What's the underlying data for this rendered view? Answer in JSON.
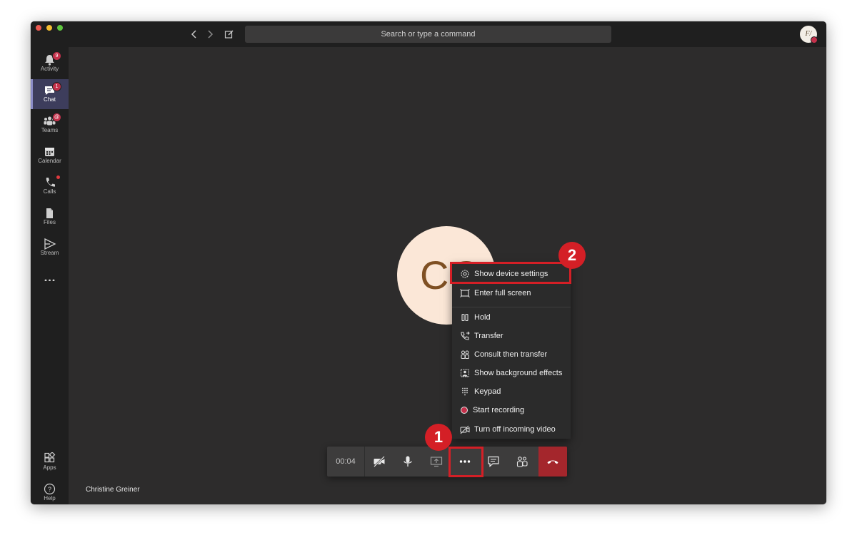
{
  "window": {
    "search_placeholder": "Search or type a command",
    "user_avatar_initials": "F/"
  },
  "sidebar": {
    "items": [
      {
        "label": "Activity",
        "icon": "bell-icon",
        "badge": "9"
      },
      {
        "label": "Chat",
        "icon": "chat-icon",
        "badge": "1",
        "active": true
      },
      {
        "label": "Teams",
        "icon": "teams-icon",
        "badge": "@"
      },
      {
        "label": "Calendar",
        "icon": "calendar-icon"
      },
      {
        "label": "Calls",
        "icon": "phone-icon",
        "badge_dot": true
      },
      {
        "label": "Files",
        "icon": "file-icon"
      },
      {
        "label": "Stream",
        "icon": "stream-icon"
      }
    ],
    "more_icon": "more-icon",
    "bottom_items": [
      {
        "label": "Apps",
        "icon": "apps-icon"
      },
      {
        "label": "Help",
        "icon": "help-icon"
      }
    ]
  },
  "call": {
    "caller_initials": "CG",
    "caller_name": "Christine Greiner",
    "duration": "00:04"
  },
  "more_menu": {
    "items": [
      {
        "label": "Show device settings",
        "icon": "gear-icon"
      },
      {
        "label": "Enter full screen",
        "icon": "fullscreen-icon"
      },
      {
        "label": "Hold",
        "icon": "hold-icon"
      },
      {
        "label": "Transfer",
        "icon": "transfer-icon"
      },
      {
        "label": "Consult then transfer",
        "icon": "consult-icon"
      },
      {
        "label": "Show background effects",
        "icon": "background-effects-icon"
      },
      {
        "label": "Keypad",
        "icon": "keypad-icon"
      },
      {
        "label": "Start recording",
        "icon": "record-icon"
      },
      {
        "label": "Turn off incoming video",
        "icon": "video-off-icon"
      }
    ]
  },
  "toolbar": {
    "buttons": [
      "camera-off-icon",
      "microphone-icon",
      "share-screen-icon",
      "more-options-icon",
      "chat-icon",
      "participants-icon",
      "hang-up-icon"
    ]
  },
  "annotations": {
    "callout_1": "1",
    "callout_2": "2"
  },
  "colors": {
    "highlight": "#d41f26",
    "hangup": "#a4262c",
    "accent": "#8b8cc7"
  }
}
